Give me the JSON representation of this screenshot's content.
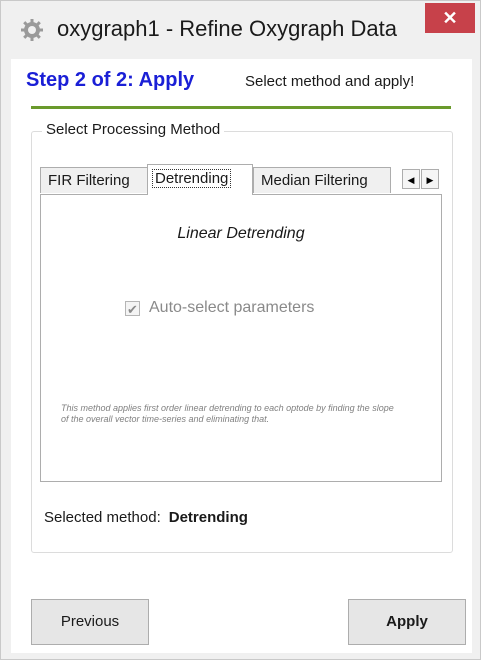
{
  "window": {
    "title": "oxygraph1 - Refine Oxygraph Data",
    "icon": "gear-icon",
    "close_label": "✕"
  },
  "header": {
    "step_title": "Step 2 of 2: Apply",
    "step_subtitle": "Select method and apply!",
    "accent_color": "#1a1fd6",
    "rule_color": "#6a9a2c"
  },
  "group": {
    "legend": "Select Processing Method",
    "tabs": [
      {
        "label": "FIR Filtering",
        "active": false
      },
      {
        "label": "Detrending",
        "active": true
      },
      {
        "label": "Median Filtering",
        "active": false
      }
    ],
    "scroll_left": "◀",
    "scroll_right": "▶",
    "panel": {
      "method_title": "Linear Detrending",
      "autoselect_label": "Auto-select parameters",
      "autoselect_checked": true,
      "check_mark": "✔",
      "description": "This method applies first order linear detrending to each optode by finding the slope of the overall vector time-series and eliminating that."
    },
    "selected_label": "Selected method:",
    "selected_value": "Detrending"
  },
  "buttons": {
    "previous": "Previous",
    "apply": "Apply"
  }
}
